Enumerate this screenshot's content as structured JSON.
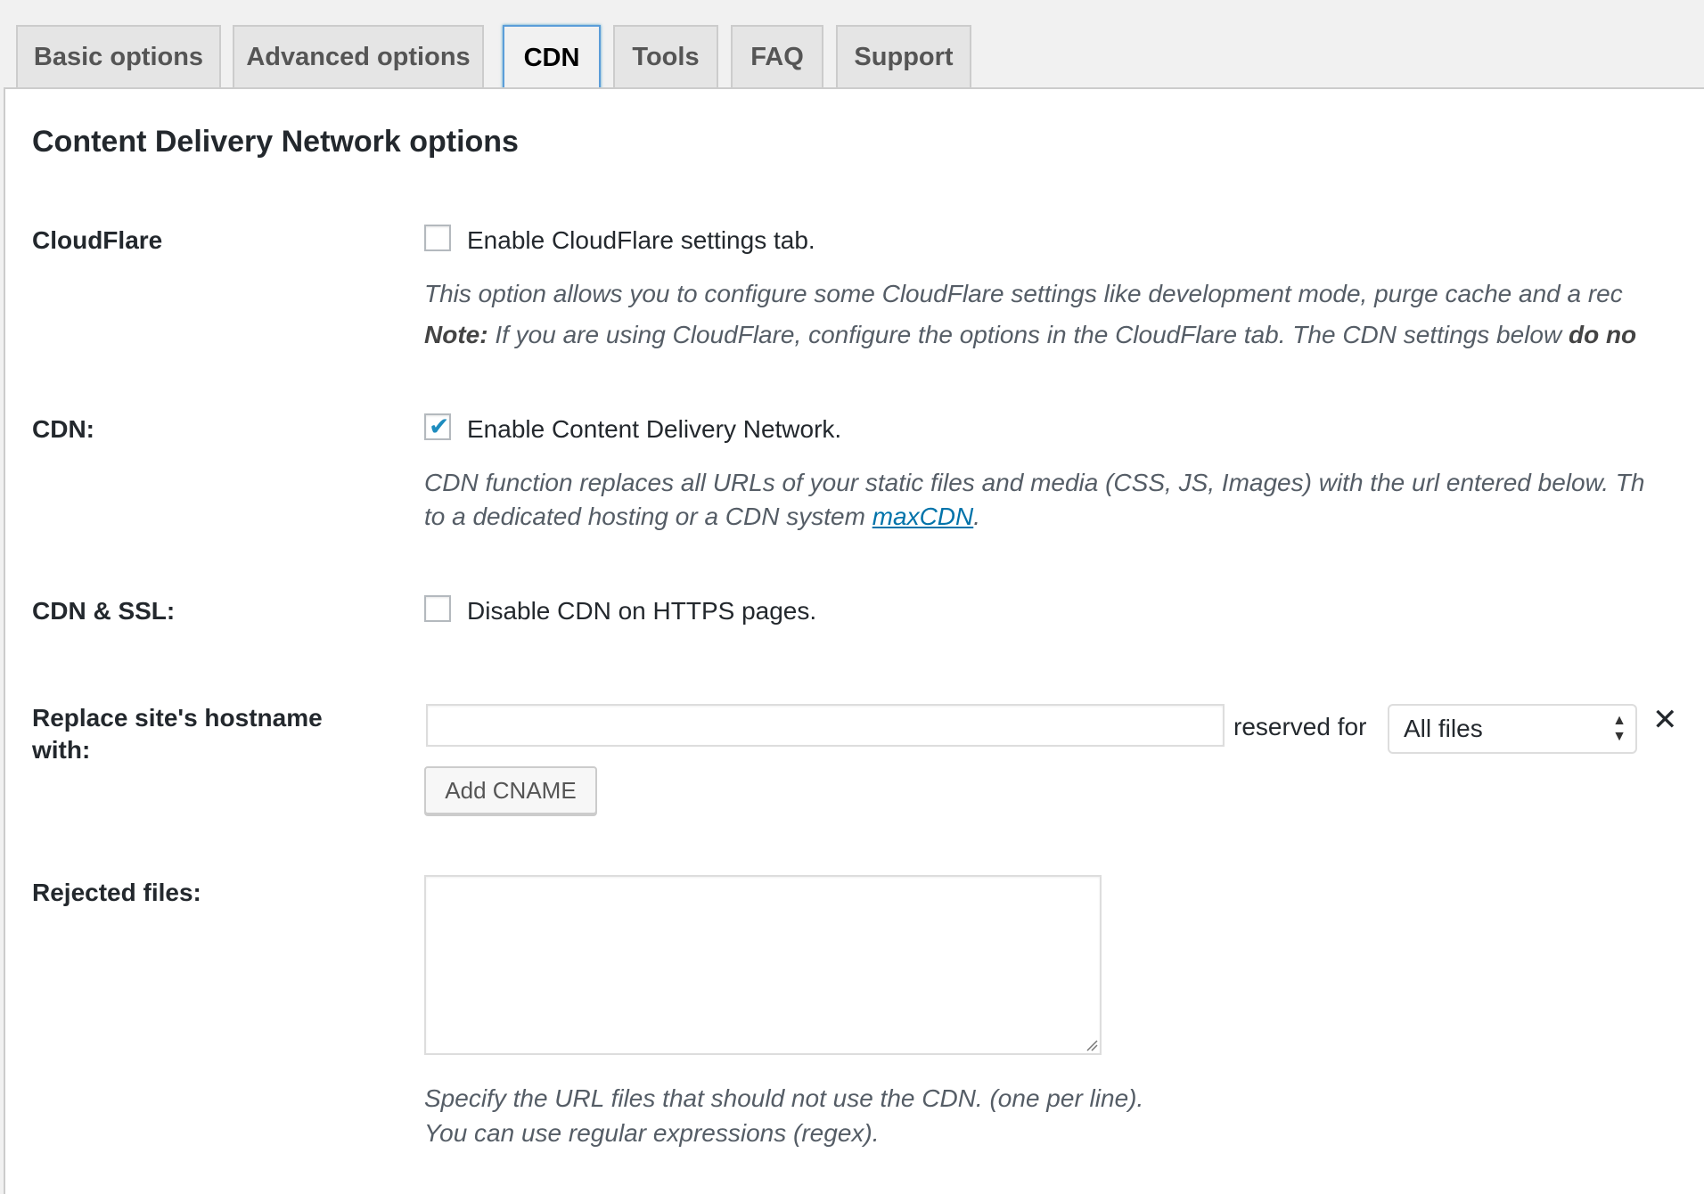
{
  "tabs": [
    {
      "label": "Basic options",
      "active": false
    },
    {
      "label": "Advanced options",
      "active": false
    },
    {
      "label": "CDN",
      "active": true
    },
    {
      "label": "Tools",
      "active": false
    },
    {
      "label": "FAQ",
      "active": false
    },
    {
      "label": "Support",
      "active": false
    }
  ],
  "page": {
    "title": "Content Delivery Network options"
  },
  "cloudflare": {
    "label": "CloudFlare",
    "checkbox_label": "Enable CloudFlare settings tab.",
    "checked": false,
    "description_line1": "This option allows you to configure some CloudFlare settings like development mode, purge cache and a rec",
    "note_prefix": "Note:",
    "note_text": " If you are using CloudFlare, configure the options in the CloudFlare tab. The CDN settings below ",
    "note_bold_tail": "do no"
  },
  "cdn": {
    "label": "CDN:",
    "checkbox_label": "Enable Content Delivery Network.",
    "checked": true,
    "description_line1": "CDN function replaces all URLs of your static files and media (CSS, JS, Images) with the url entered below. Th",
    "description_line2_prefix": "to a dedicated hosting or a CDN system ",
    "link_text": "maxCDN",
    "description_line2_suffix": "."
  },
  "cdn_ssl": {
    "label": "CDN & SSL:",
    "checkbox_label": "Disable CDN on HTTPS pages.",
    "checked": false
  },
  "hostname": {
    "label_line1": "Replace site's hostname",
    "label_line2": "with:",
    "input_value": "",
    "reserved_for_label": "reserved for",
    "select_value": "All files",
    "remove_symbol": "✕",
    "add_button_label": "Add CNAME"
  },
  "rejected": {
    "label": "Rejected files:",
    "value": "",
    "help_line1": "Specify the URL files that should not use the CDN. (one per line).",
    "help_line2": "You can use regular expressions (regex)."
  },
  "colors": {
    "accent": "#1e8cbe",
    "link": "#0073aa"
  }
}
